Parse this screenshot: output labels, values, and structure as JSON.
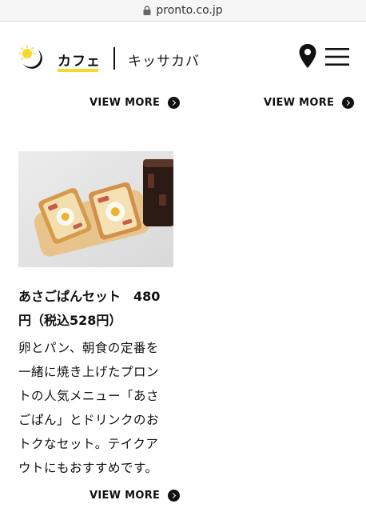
{
  "browser": {
    "url": "pronto.co.jp"
  },
  "header": {
    "tab_cafe": "カフェ",
    "tab_kissa": "キッサカバ"
  },
  "view_more": [
    "VIEW MORE",
    "VIEW MORE",
    "VIEW MORE"
  ],
  "product": {
    "title_line1": "あさごぱんセット　480",
    "title_line2": "円（税込528円）",
    "desc_lines": [
      "卵とパン、朝食の定番を",
      "一緒に焼き上げたプロン",
      "トの人気メニュー「あさ",
      "ごぱん」とドリンクのお",
      "トクなセット。テイクア",
      "ウトにもおすすめです。"
    ]
  },
  "icons": {
    "logo": "sun-moon-logo",
    "location": "map-pin-icon",
    "menu": "hamburger-menu-icon",
    "arrow": "circle-arrow-right-icon",
    "lock": "lock-icon"
  },
  "colors": {
    "accent_yellow": "#f3d92c",
    "text": "#111111"
  }
}
